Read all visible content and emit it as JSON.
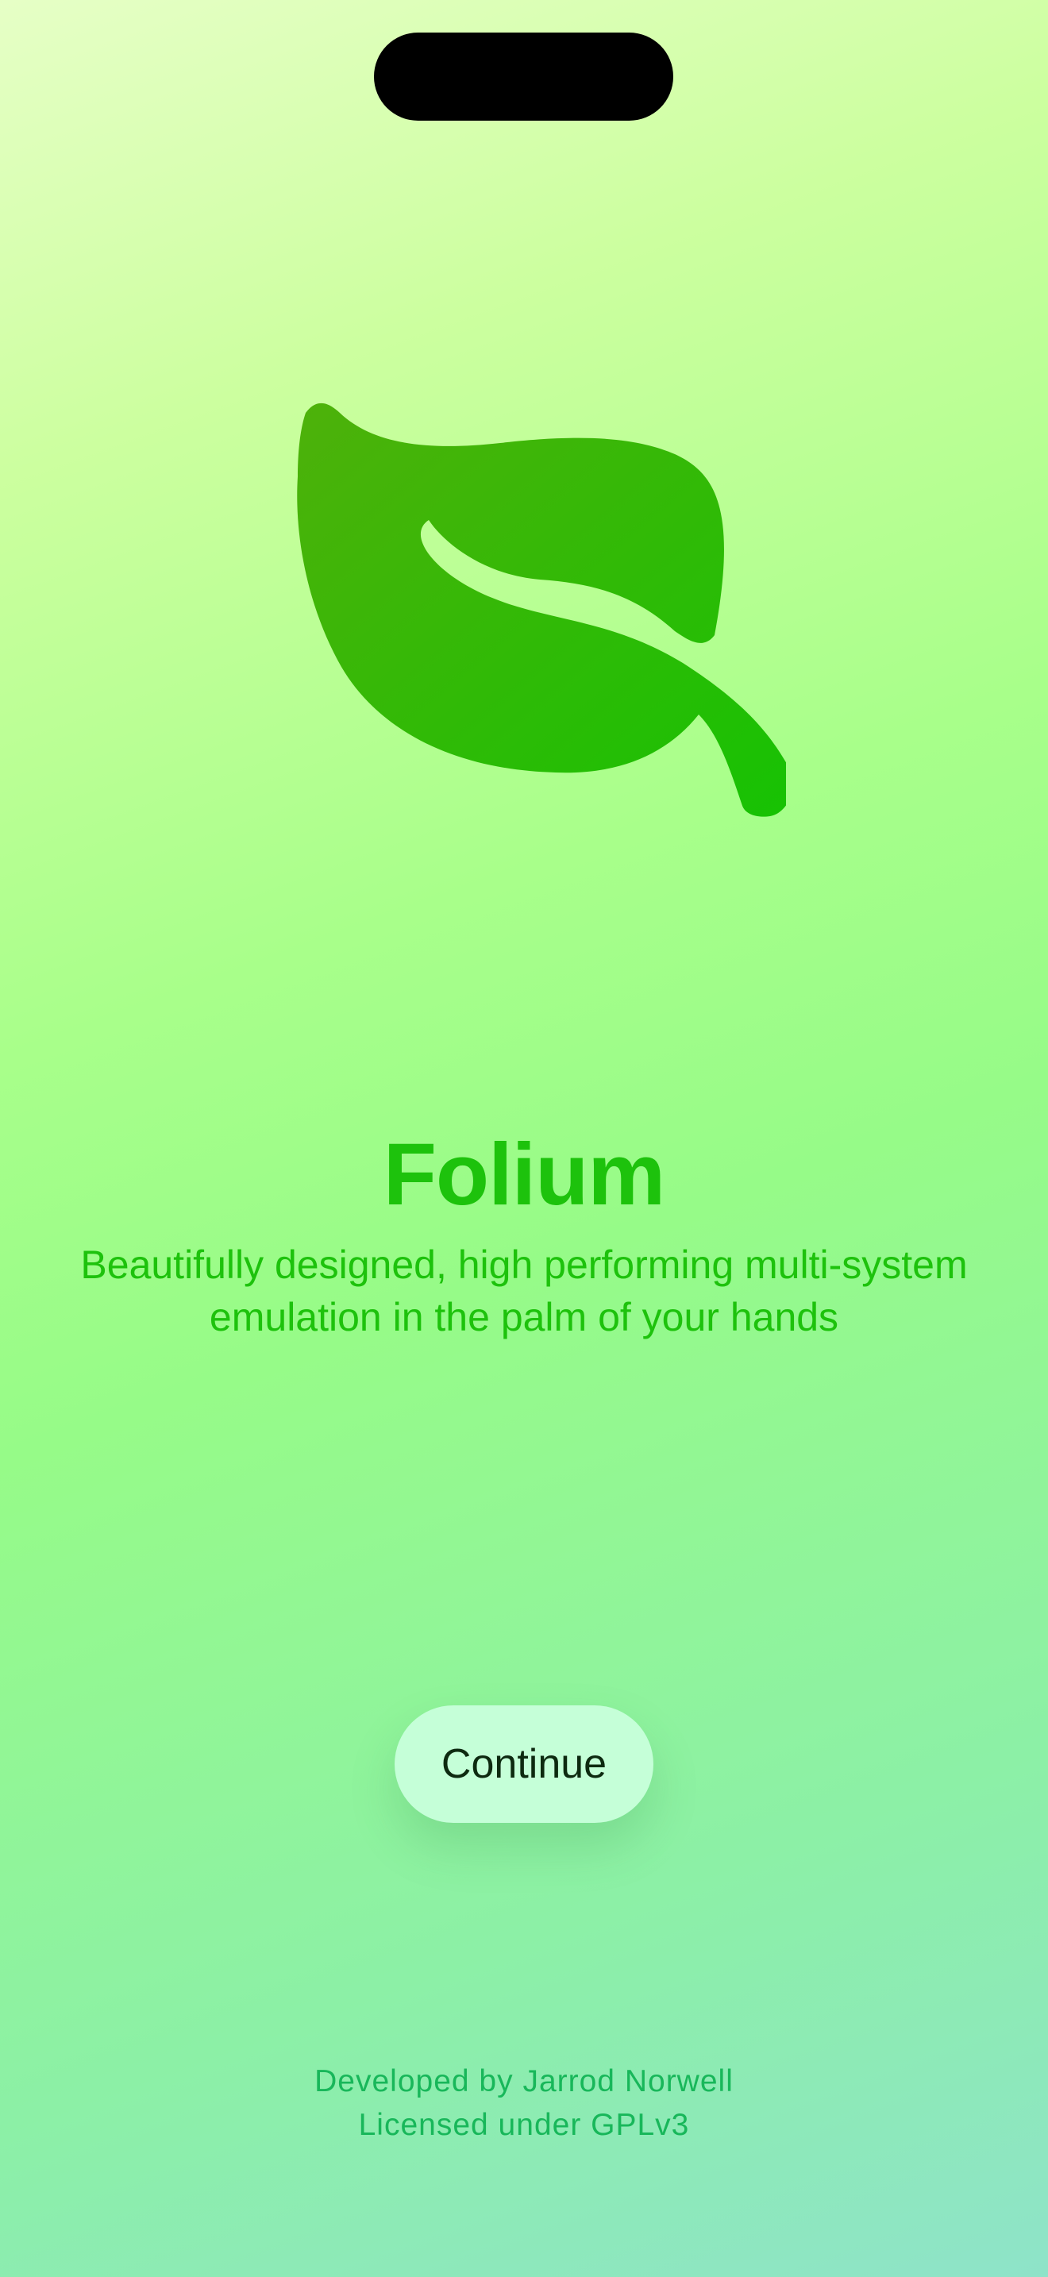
{
  "app": {
    "name": "Folium",
    "tagline": "Beautifully designed, high performing multi-system emulation in the palm of your hands",
    "icon": "leaf-icon"
  },
  "actions": {
    "continue_label": "Continue"
  },
  "footer": {
    "developer": "Developed by Jarrod Norwell",
    "license": "Licensed under GPLv3"
  },
  "colors": {
    "accent": "#1dc20c",
    "leaf_top": "#4eb10a",
    "leaf_bottom": "#16c203",
    "button_bg": "#c5ffd8",
    "footer_text": "#18b75a"
  }
}
